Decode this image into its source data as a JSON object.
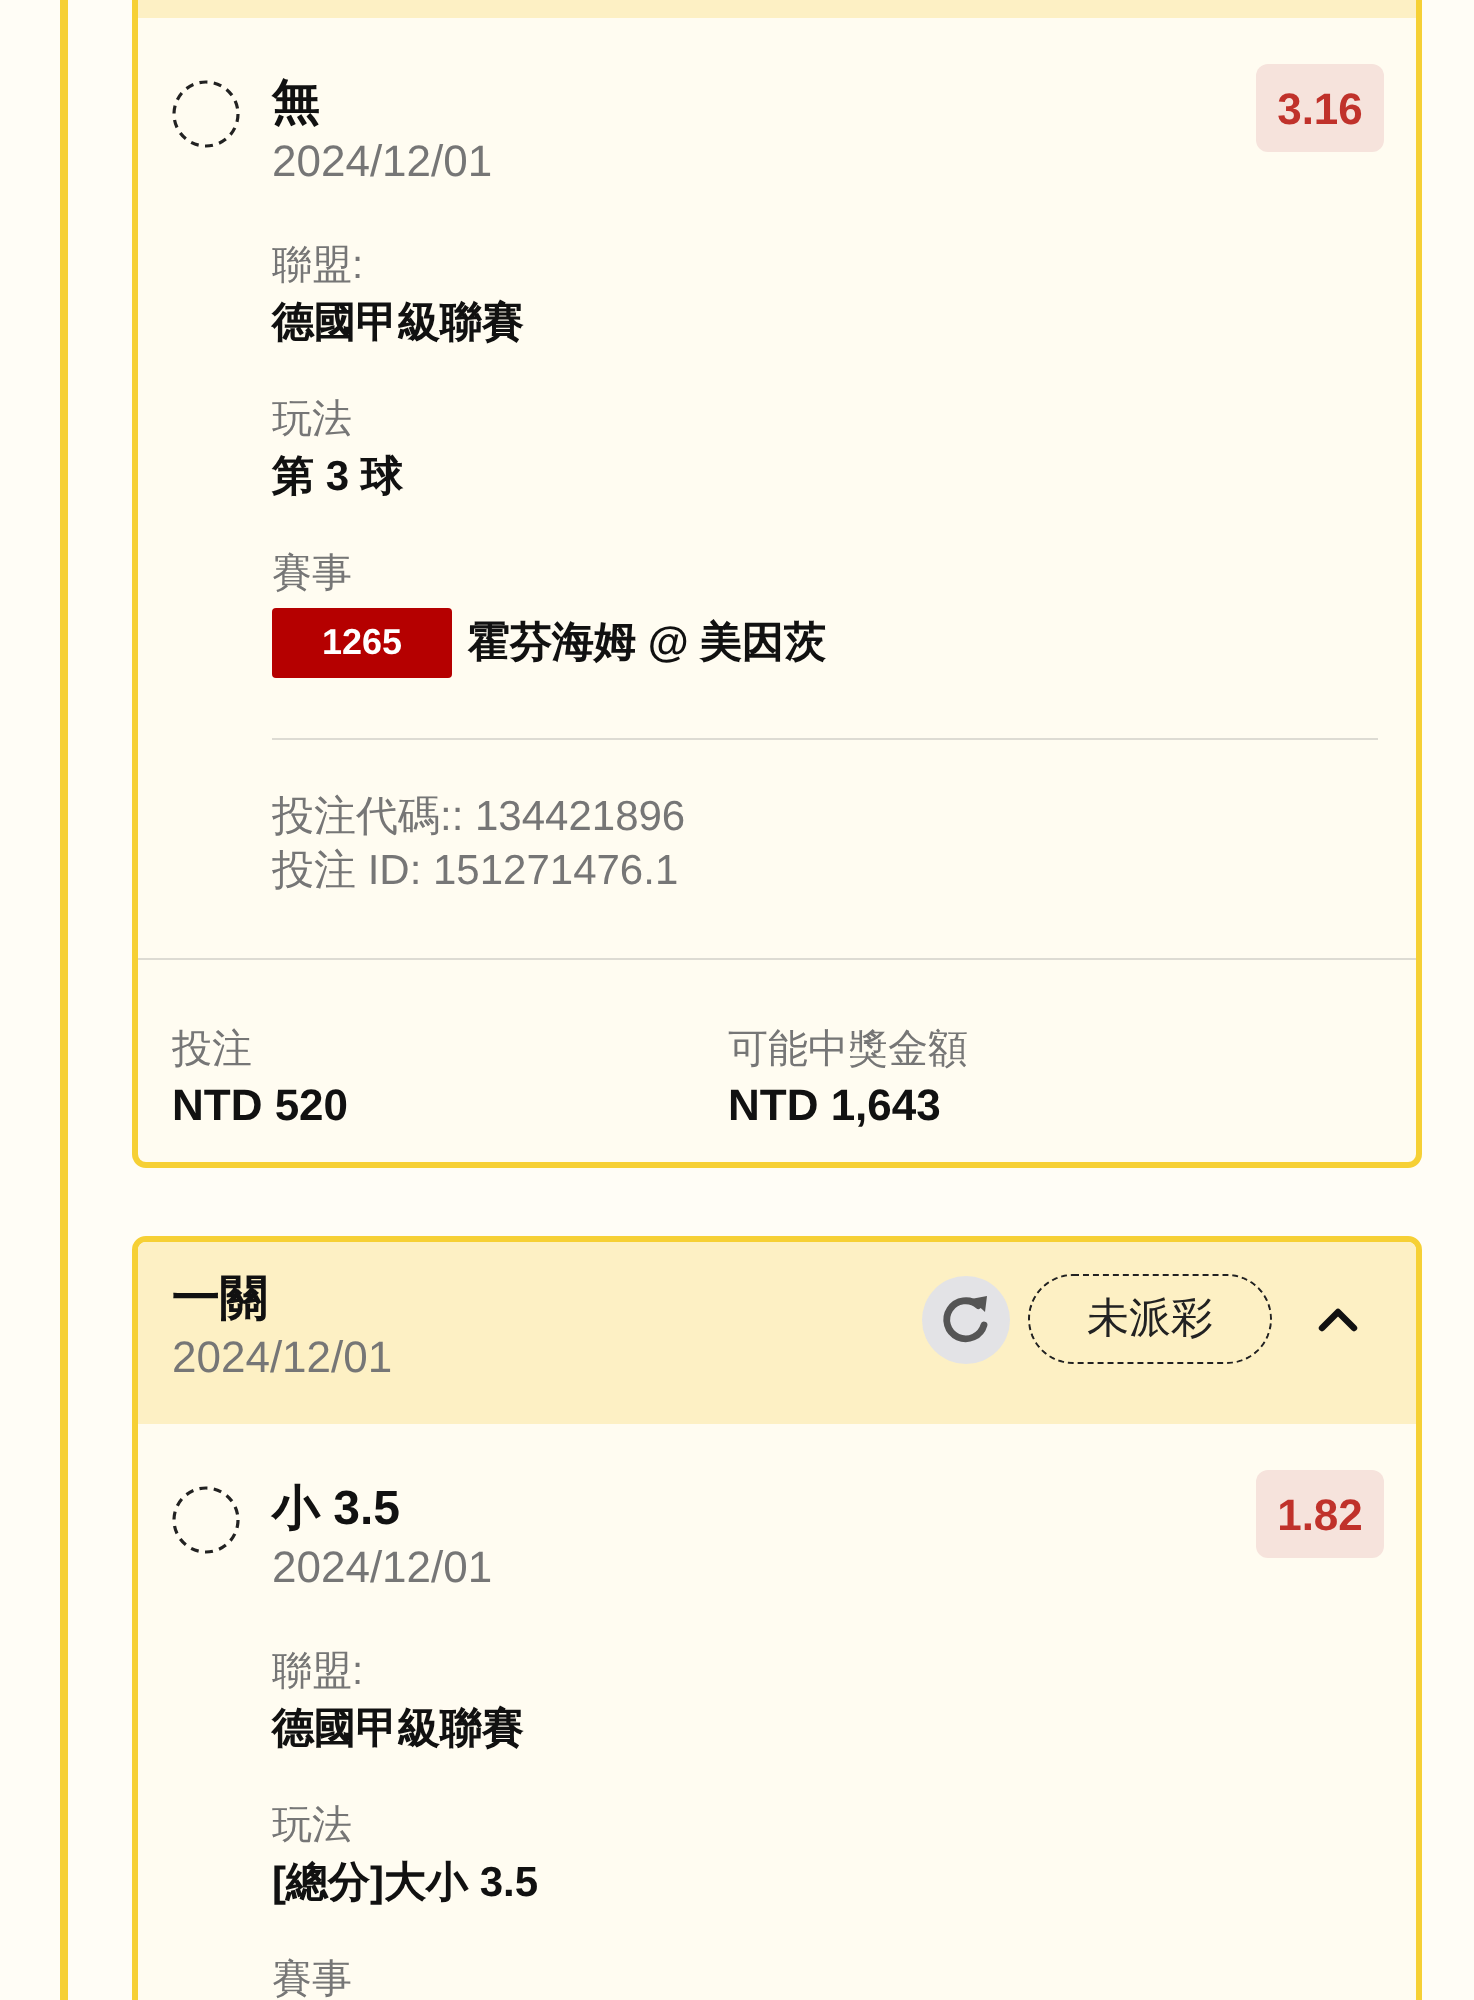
{
  "tickets": [
    {
      "selections": [
        {
          "pick": "無",
          "date": "2024/12/01",
          "odds": "3.16",
          "details": [
            {
              "kind": "text",
              "label": "聯盟:",
              "value": "德國甲級聯賽"
            },
            {
              "kind": "text",
              "label": "玩法",
              "value": "第 3 球"
            },
            {
              "kind": "event",
              "label": "賽事",
              "event_no": "1265",
              "value": "霍芬海姆 @ 美因茨"
            }
          ],
          "bet_code": "投注代碼:: 134421896",
          "bet_id": "投注 ID: 151271476.1"
        }
      ],
      "footer": {
        "stake_label": "投注",
        "stake": "NTD 520",
        "payout_label": "可能中獎金額",
        "payout": "NTD 1,643"
      }
    },
    {
      "header": {
        "title": "一關",
        "date": "2024/12/01",
        "status": "未派彩",
        "expanded": true
      },
      "selections": [
        {
          "pick": "小 3.5",
          "date": "2024/12/01",
          "odds": "1.82",
          "details": [
            {
              "kind": "text",
              "label": "聯盟:",
              "value": "德國甲級聯賽"
            },
            {
              "kind": "text",
              "label": "玩法",
              "value": "[總分]大小 3.5"
            },
            {
              "kind": "text",
              "label": "賽事"
            }
          ]
        }
      ]
    }
  ]
}
